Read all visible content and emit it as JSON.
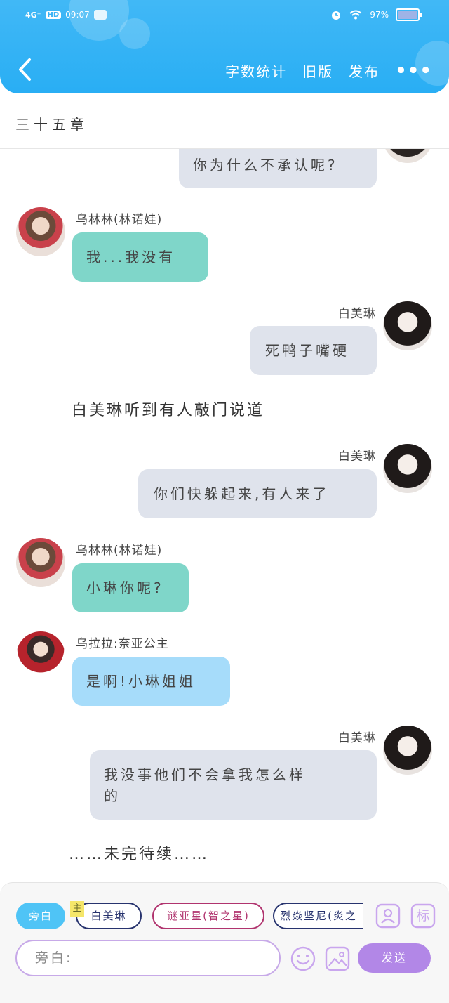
{
  "status_bar": {
    "network": "4G⁺",
    "hd": "HD",
    "time": "09:07",
    "battery": "97%",
    "battery_level": 0.97
  },
  "header": {
    "actions": [
      "字数统计",
      "旧版",
      "发布"
    ],
    "more": "•••"
  },
  "chapter": {
    "title": "三十五章"
  },
  "chat": {
    "top_partial": {
      "text": "你为什么不承认呢?"
    },
    "messages": [
      {
        "speaker": "乌林林(林诺娃)",
        "text": "我...我没有"
      },
      {
        "speaker": "白美琳",
        "text": "死鸭子嘴硬"
      },
      {
        "narration": "白美琳听到有人敲门说道"
      },
      {
        "speaker": "白美琳",
        "text": "你们快躲起来,有人来了"
      },
      {
        "speaker": "乌林林(林诺娃)",
        "text": "小琳你呢?"
      },
      {
        "speaker": "乌拉拉:奈亚公主",
        "text": "是啊!小琳姐姐"
      },
      {
        "speaker": "白美琳",
        "text_line1": "我没事他们不会拿我怎么样",
        "text_line2": "的"
      },
      {
        "narration": "……未完待续……"
      }
    ]
  },
  "composer": {
    "chips": [
      "旁白",
      "白美琳",
      "谜亚星(智之星)",
      "烈焱坚尼(炎之"
    ],
    "main_tag": "主",
    "mark_label": "标",
    "input_placeholder": "旁白:",
    "send_label": "发送"
  },
  "colors": {
    "header": "#29aef4",
    "teal_bubble": "#7fd6c9",
    "blue_bubble": "#a6dcfa",
    "gray_bubble": "#dfe3ec",
    "send": "#b287e7"
  }
}
